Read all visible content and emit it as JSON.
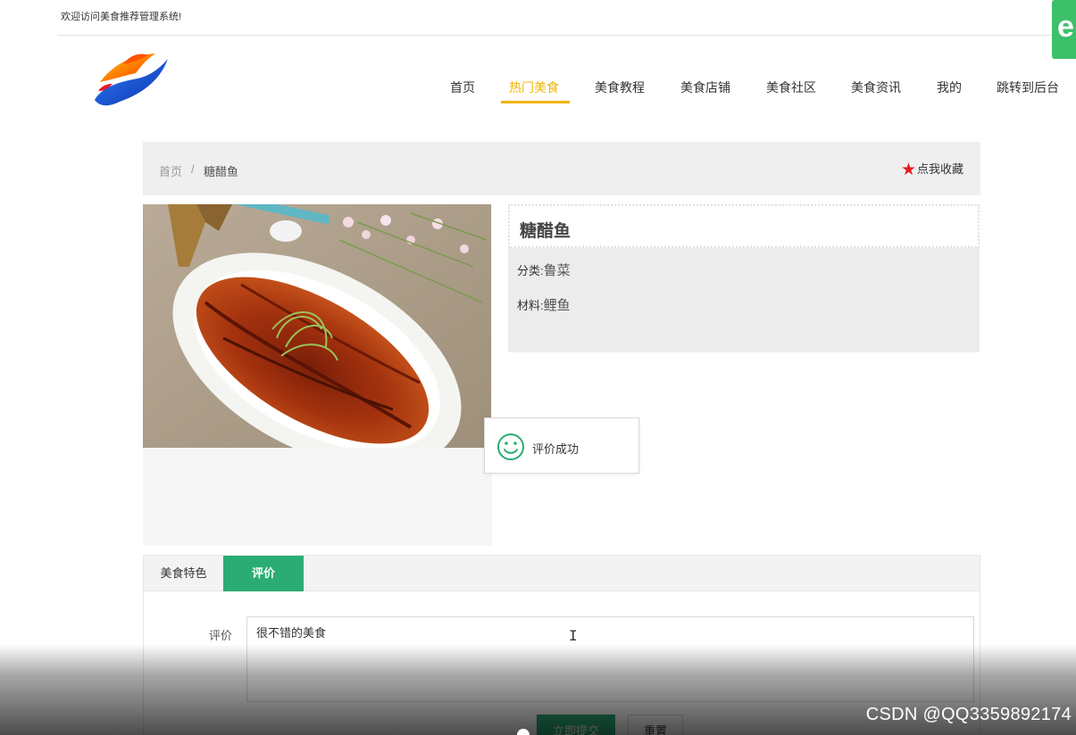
{
  "topbar": {
    "welcome": "欢迎访问美食推荐管理系统!"
  },
  "corner_badge": {
    "letter": "e",
    "color": "#3cc06a"
  },
  "nav": {
    "items": [
      {
        "label": "首页"
      },
      {
        "label": "热门美食"
      },
      {
        "label": "美食教程"
      },
      {
        "label": "美食店铺"
      },
      {
        "label": "美食社区"
      },
      {
        "label": "美食资讯"
      },
      {
        "label": "我的"
      },
      {
        "label": "跳转到后台"
      }
    ],
    "active_index": 1,
    "active_color": "#f0b400"
  },
  "breadcrumb": {
    "home": "首页",
    "separator": "/",
    "current": "糖醋鱼"
  },
  "favorite": {
    "label": "点我收藏",
    "icon": "star-icon"
  },
  "food": {
    "name": "糖醋鱼",
    "category_label": "分类:",
    "category_value": "鲁菜",
    "material_label": "材料:",
    "material_value": "鲤鱼"
  },
  "toast": {
    "icon": "smile-icon",
    "message": "评价成功",
    "icon_color": "#2aac74"
  },
  "tabs": [
    {
      "label": "美食特色"
    },
    {
      "label": "评价"
    }
  ],
  "active_tab": 1,
  "comment_form": {
    "label": "评价",
    "value": "很不错的美食",
    "submit": "立即提交",
    "reset": "重置"
  },
  "accent_color": "#2aac74",
  "watermark": "CSDN @QQ3359892174"
}
